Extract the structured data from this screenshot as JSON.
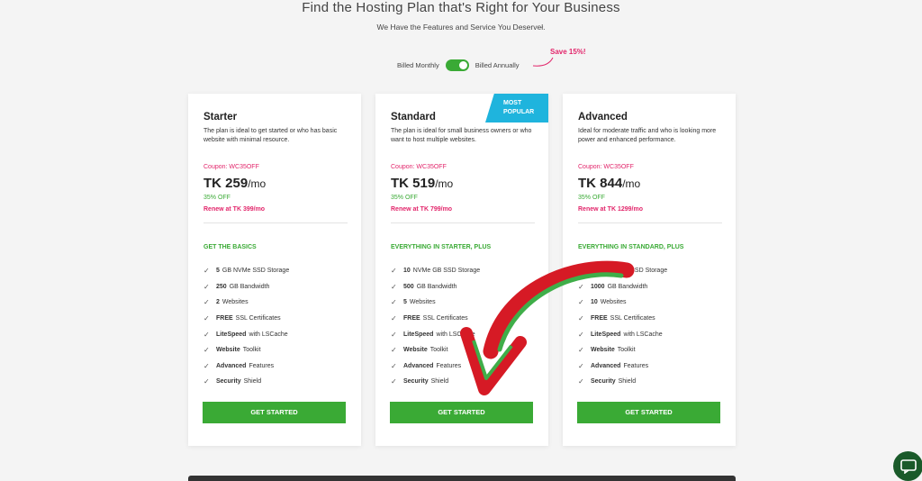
{
  "header": {
    "title": "Find the Hosting Plan that's Right for Your Business",
    "subtitle": "We Have the Features and Service You Deserveł."
  },
  "billing": {
    "monthly_label": "Billed Monthly",
    "annually_label": "Billed Annually",
    "save_label": "Save 15%!",
    "selected": "Billed Annually"
  },
  "plans": [
    {
      "name": "Starter",
      "desc": "The plan is ideal to get started or who has basic website with minimal resource.",
      "coupon": "Coupon: WC35OFF",
      "price": "TK 259",
      "per": "/mo",
      "off": "35% OFF",
      "renew": "Renew at TK 399/mo",
      "section": "GET THE BASICS",
      "features": [
        {
          "bold": "5",
          "text": "GB NVMe SSD Storage"
        },
        {
          "bold": "250",
          "text": "GB Bandwidth"
        },
        {
          "bold": "2",
          "text": "Websites"
        },
        {
          "bold": "FREE",
          "text": "SSL Certificates"
        },
        {
          "bold": "LiteSpeed",
          "text": "with LSCache"
        },
        {
          "bold": "Website",
          "text": "Toolkit"
        },
        {
          "bold": "Advanced",
          "text": "Features"
        },
        {
          "bold": "Security",
          "text": "Shield"
        }
      ],
      "button": "GET STARTED"
    },
    {
      "name": "Standard",
      "badge": "MOST POPULAR",
      "desc": "The plan is ideal for small business owners or who want to host multiple websites.",
      "coupon": "Coupon: WC35OFF",
      "price": "TK 519",
      "per": "/mo",
      "off": "35% OFF",
      "renew": "Renew at TK 799/mo",
      "section": "EVERYTHING IN STARTER, PLUS",
      "features": [
        {
          "bold": "10",
          "text": "NVMe GB SSD Storage"
        },
        {
          "bold": "500",
          "text": "GB Bandwidth"
        },
        {
          "bold": "5",
          "text": "Websites"
        },
        {
          "bold": "FREE",
          "text": "SSL Certificates"
        },
        {
          "bold": "LiteSpeed",
          "text": "with LSCache"
        },
        {
          "bold": "Website",
          "text": "Toolkit"
        },
        {
          "bold": "Advanced",
          "text": "Features"
        },
        {
          "bold": "Security",
          "text": "Shield"
        }
      ],
      "button": "GET STARTED"
    },
    {
      "name": "Advanced",
      "desc": "Ideal for moderate traffic and who is looking more power and enhanced performance.",
      "coupon": "Coupon: WC35OFF",
      "price": "TK 844",
      "per": "/mo",
      "off": "35% OFF",
      "renew": "Renew at TK 1299/mo",
      "section": "EVERYTHING IN STANDARD, PLUS",
      "features": [
        {
          "bold": "20",
          "text": "NVMe GB SSD Storage"
        },
        {
          "bold": "1000",
          "text": "GB Bandwidth"
        },
        {
          "bold": "10",
          "text": "Websites"
        },
        {
          "bold": "FREE",
          "text": "SSL Certificates"
        },
        {
          "bold": "LiteSpeed",
          "text": "with LSCache"
        },
        {
          "bold": "Website",
          "text": "Toolkit"
        },
        {
          "bold": "Advanced",
          "text": "Features"
        },
        {
          "bold": "Security",
          "text": "Shield"
        }
      ],
      "button": "GET STARTED"
    }
  ],
  "colors": {
    "accent_green": "#3aaa35",
    "accent_pink": "#e2266b",
    "badge_blue": "#1fb4dd"
  },
  "icons": {
    "feature_check": "check-icon",
    "chat": "chat-bubble-icon",
    "annotation": "red-green-arrow"
  }
}
